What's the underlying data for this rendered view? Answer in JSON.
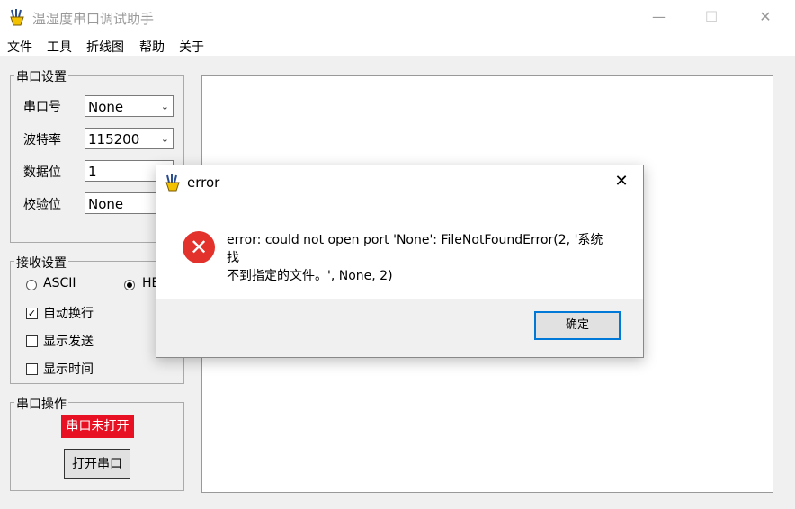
{
  "window": {
    "title": "温湿度串口调试助手",
    "minimize": "—",
    "maximize": "☐",
    "close": "✕"
  },
  "menu": {
    "items": [
      "文件",
      "工具",
      "折线图",
      "帮助",
      "关于"
    ]
  },
  "serial_settings": {
    "group_label": "串口设置",
    "port_label": "串口号",
    "port_value": "None",
    "baud_label": "波特率",
    "baud_value": "115200",
    "databits_label": "数据位",
    "databits_value": "1",
    "parity_label": "校验位",
    "parity_value": "None"
  },
  "receive_settings": {
    "group_label": "接收设置",
    "ascii_label": "ASCII",
    "hex_label": "HE",
    "auto_wrap_label": "自动换行",
    "show_send_label": "显示发送",
    "show_time_label": "显示时间",
    "auto_wrap_checked": true,
    "show_send_checked": false,
    "show_time_checked": false
  },
  "serial_ops": {
    "group_label": "串口操作",
    "status_text": "串口未打开",
    "open_button": "打开串口",
    "status_color": "#e81123"
  },
  "dialog": {
    "title": "error",
    "close": "✕",
    "icon": "error-icon",
    "message_line1": "error: could not open port 'None': FileNotFoundError(2, '系统找",
    "message_line2": "不到指定的文件。', None, 2)",
    "ok_button": "确定",
    "accent_color": "#0078d7",
    "icon_color": "#e3312b"
  }
}
